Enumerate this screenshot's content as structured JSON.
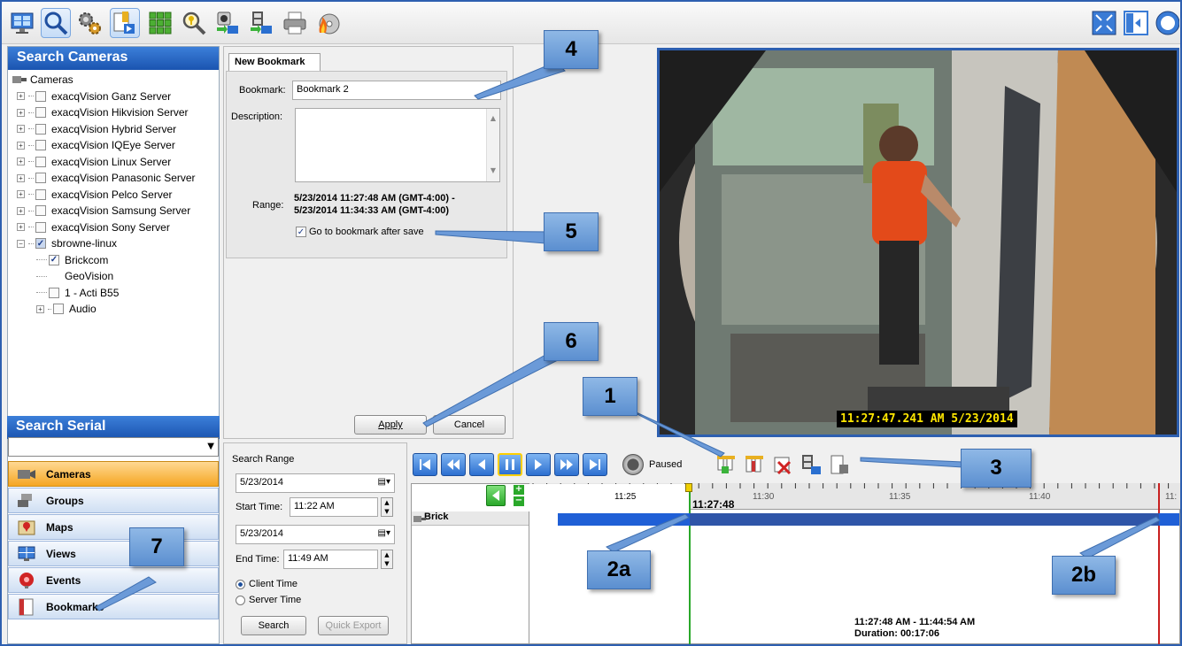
{
  "toolbar": {
    "icons": [
      "live-view-icon",
      "search-icon",
      "config-icon",
      "bookmark-toolbar-icon",
      "layout-grid-icon",
      "key-search-icon",
      "camera-export-icon",
      "video-export-icon",
      "print-icon",
      "burn-disc-icon"
    ],
    "right_icons": [
      "fullscreen-icon",
      "back-icon",
      "help-icon"
    ]
  },
  "left": {
    "search_cameras_title": "Search Cameras",
    "root_label": "Cameras",
    "servers": [
      "exacqVision Ganz Server",
      "exacqVision Hikvision Server",
      "exacqVision Hybrid Server",
      "exacqVision IQEye Server",
      "exacqVision Linux Server",
      "exacqVision Panasonic Server",
      "exacqVision Pelco Server",
      "exacqVision Samsung Server",
      "exacqVision Sony Server"
    ],
    "selected_server": "sbrowne-linux",
    "children": [
      "Brickcom",
      "GeoVision",
      "1 - Acti B55",
      "Audio"
    ],
    "search_serial_title": "Search Serial",
    "nav": [
      "Cameras",
      "Groups",
      "Maps",
      "Views",
      "Events",
      "Bookmarks"
    ]
  },
  "bookmark": {
    "tab": "New Bookmark",
    "bookmark_label": "Bookmark:",
    "bookmark_value": "Bookmark 2",
    "description_label": "Description:",
    "range_label": "Range:",
    "range_line1": "5/23/2014 11:27:48 AM (GMT-4:00) -",
    "range_line2": "5/23/2014 11:34:33 AM (GMT-4:00)",
    "goto_label": "Go to bookmark after save",
    "apply": "Apply",
    "cancel": "Cancel"
  },
  "video": {
    "timestamp": "11:27:47.241 AM 5/23/2014"
  },
  "search": {
    "title": "Search Range",
    "start_date": "5/23/2014",
    "start_time_label": "Start Time:",
    "start_time": "11:22 AM",
    "end_date": "5/23/2014",
    "end_time_label": "End Time:",
    "end_time": "11:49 AM",
    "client_time": "Client Time",
    "server_time": "Server Time",
    "search_btn": "Search",
    "export_btn": "Quick Export"
  },
  "playback": {
    "status": "Paused"
  },
  "timeline": {
    "ticks": [
      "11:25",
      "11:30",
      "11:35",
      "11:40",
      "11:"
    ],
    "current": "11:27:48",
    "track": "Brick",
    "selection_range": "11:27:48 AM - 11:44:54 AM",
    "duration": "Duration: 00:17:06"
  },
  "callouts": [
    "1",
    "2a",
    "2b",
    "3",
    "4",
    "5",
    "6",
    "7"
  ],
  "colors": {
    "accent": "#2d5fb0",
    "callout": "#6b9ad8",
    "timestamp": "#ffe600",
    "timeline_bar": "#1f5fd6",
    "nav_active": "#f5a623"
  }
}
